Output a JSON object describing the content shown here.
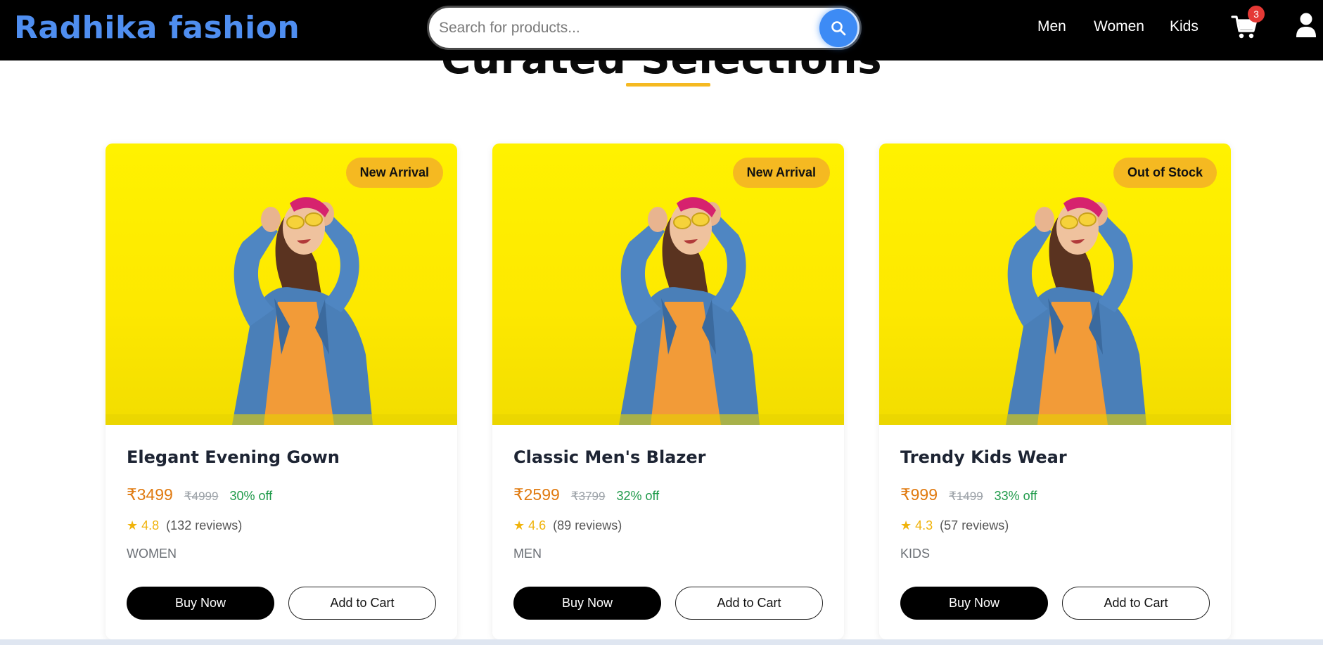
{
  "section": {
    "title": "Curated Selections"
  },
  "navbar": {
    "brand": "Radhika fashion",
    "search_placeholder": "Search for products...",
    "links": [
      "Men",
      "Women",
      "Kids"
    ],
    "cart_count": "3"
  },
  "colors": {
    "brand": "#4f8ef0",
    "accent": "#f5b921",
    "price": "#e07a10",
    "discount": "#1f9a4a",
    "badge": "#e53935"
  },
  "icons": [
    "search-icon",
    "cart-icon",
    "user-icon",
    "star-icon"
  ],
  "products": [
    {
      "badge": "New Arrival",
      "name": "Elegant Evening Gown",
      "price": "₹3499",
      "old_price": "₹4999",
      "discount": "30% off",
      "rating": "★ 4.8",
      "reviews": "(132 reviews)",
      "category": "WOMEN",
      "buy_label": "Buy Now",
      "cart_label": "Add to Cart"
    },
    {
      "badge": "New Arrival",
      "name": "Classic Men's Blazer",
      "price": "₹2599",
      "old_price": "₹3799",
      "discount": "32% off",
      "rating": "★ 4.6",
      "reviews": "(89 reviews)",
      "category": "MEN",
      "buy_label": "Buy Now",
      "cart_label": "Add to Cart"
    },
    {
      "badge": "Out of Stock",
      "name": "Trendy Kids Wear",
      "price": "₹999",
      "old_price": "₹1499",
      "discount": "33% off",
      "rating": "★ 4.3",
      "reviews": "(57 reviews)",
      "category": "KIDS",
      "buy_label": "Buy Now",
      "cart_label": "Add to Cart"
    }
  ]
}
